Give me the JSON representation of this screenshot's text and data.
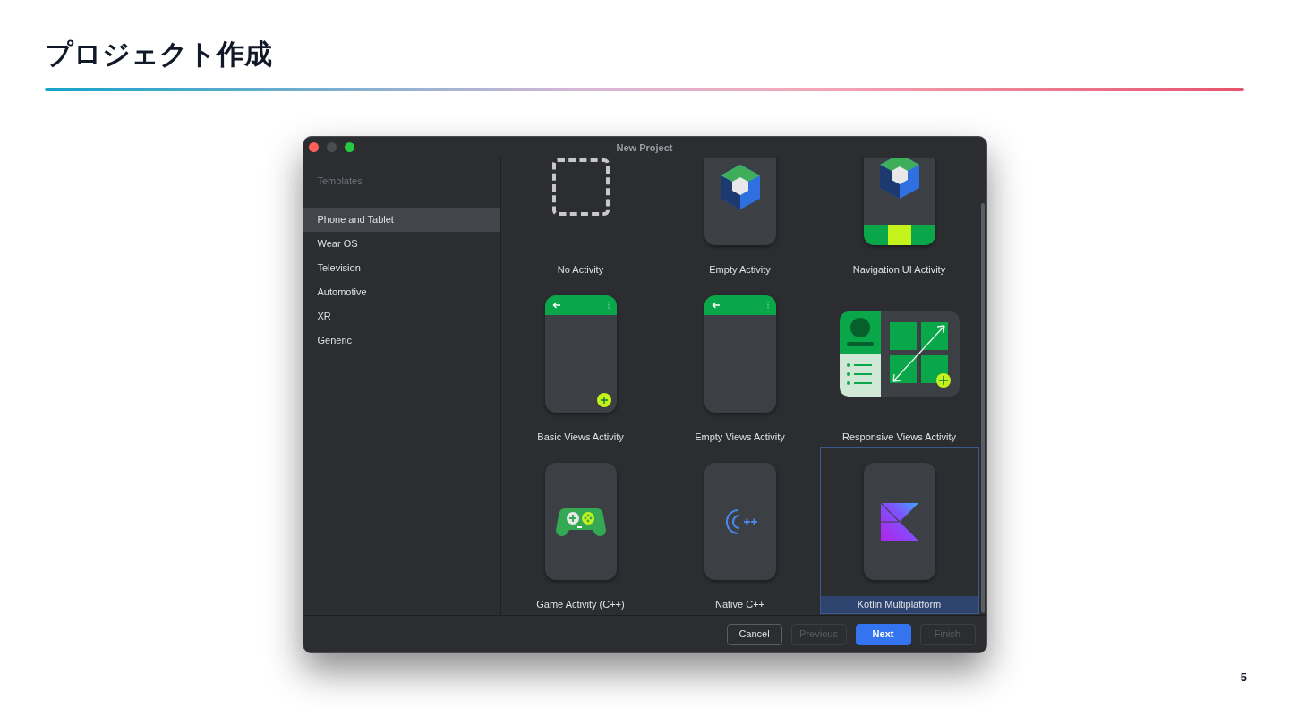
{
  "slide": {
    "title": "プロジェクト作成",
    "page_number": "5"
  },
  "window": {
    "title": "New Project",
    "sidebar": {
      "heading": "Templates",
      "items": [
        {
          "label": "Phone and Tablet",
          "selected": true
        },
        {
          "label": "Wear OS",
          "selected": false
        },
        {
          "label": "Television",
          "selected": false
        },
        {
          "label": "Automotive",
          "selected": false
        },
        {
          "label": "XR",
          "selected": false
        },
        {
          "label": "Generic",
          "selected": false
        }
      ]
    },
    "templates": [
      {
        "label": "No Activity",
        "kind": "blank",
        "selected": false
      },
      {
        "label": "Empty Activity",
        "kind": "cube",
        "selected": false
      },
      {
        "label": "Navigation UI Activity",
        "kind": "nav",
        "selected": false
      },
      {
        "label": "Basic Views Activity",
        "kind": "basic",
        "selected": false
      },
      {
        "label": "Empty Views Activity",
        "kind": "views",
        "selected": false
      },
      {
        "label": "Responsive Views Activity",
        "kind": "responsive",
        "selected": false
      },
      {
        "label": "Game Activity (C++)",
        "kind": "game",
        "selected": false
      },
      {
        "label": "Native C++",
        "kind": "cpp",
        "selected": false
      },
      {
        "label": "Kotlin Multiplatform",
        "kind": "kotlin",
        "selected": true
      }
    ],
    "buttons": [
      {
        "label": "Cancel",
        "disabled": false,
        "primary": false
      },
      {
        "label": "Previous",
        "disabled": true,
        "primary": false
      },
      {
        "label": "Next",
        "disabled": false,
        "primary": true
      },
      {
        "label": "Finish",
        "disabled": true,
        "primary": false
      }
    ]
  }
}
